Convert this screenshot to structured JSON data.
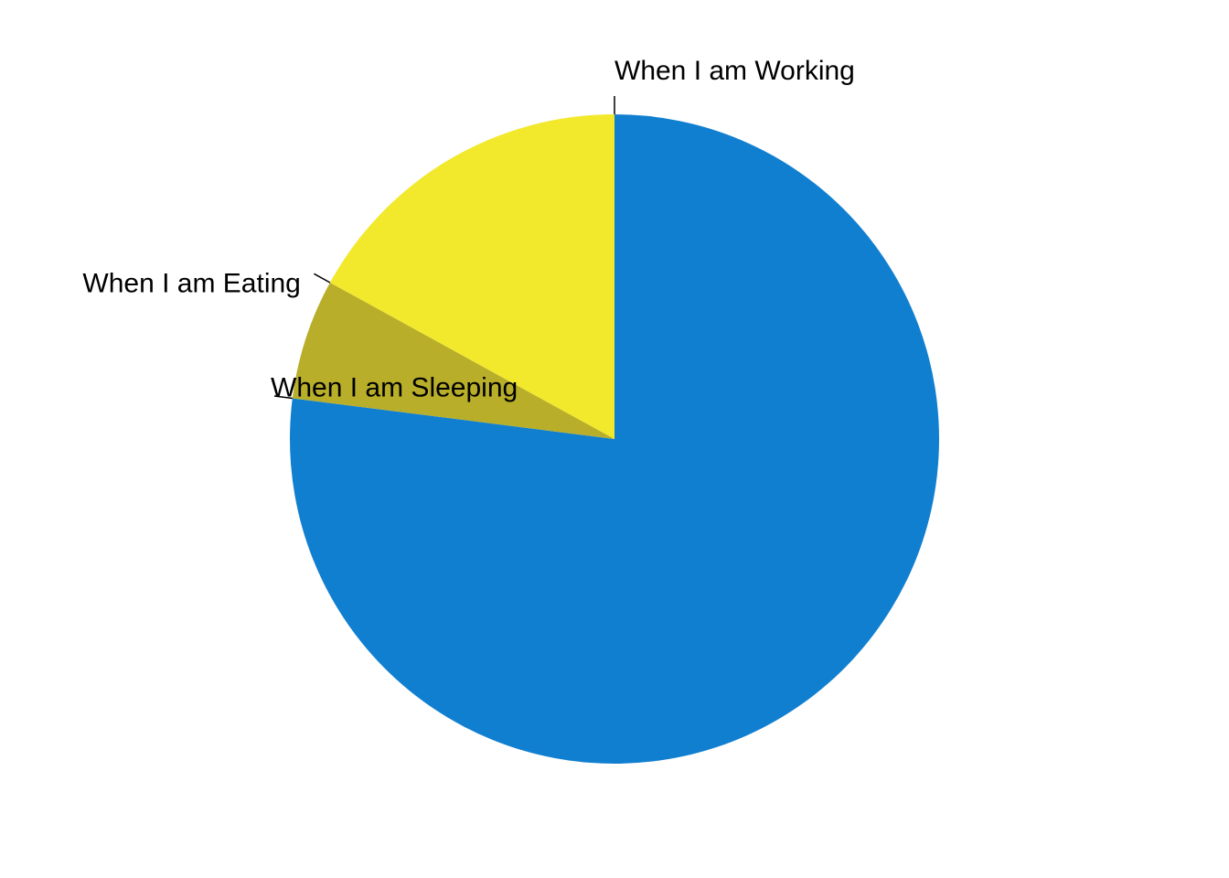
{
  "chart_data": {
    "type": "pie",
    "title": "",
    "start_angle_deg": 0,
    "direction": "clockwise",
    "slices": [
      {
        "label": "When I am Working",
        "value": 77,
        "color": "#117FD0"
      },
      {
        "label": "When I am Sleeping",
        "value": 6,
        "color": "#B8AE29"
      },
      {
        "label": "When I am Eating",
        "value": 17,
        "color": "#F2E92D"
      }
    ]
  }
}
